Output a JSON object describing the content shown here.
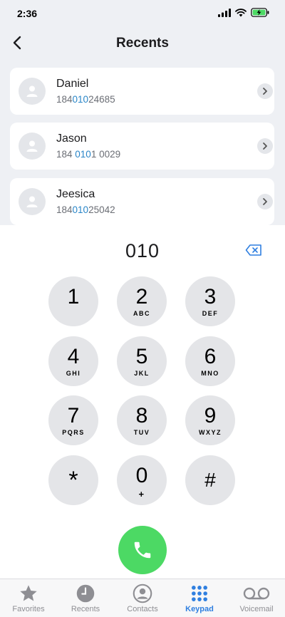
{
  "status_bar": {
    "time": "2:36"
  },
  "nav": {
    "title": "Recents"
  },
  "contacts": [
    {
      "name": "Daniel",
      "number_prefix": "184",
      "number_match": "010",
      "number_suffix": "24685"
    },
    {
      "name": "Jason",
      "number_prefix": "184 ",
      "number_match": "010",
      "number_suffix": "1 0029"
    },
    {
      "name": "Jeesica",
      "number_prefix": "184",
      "number_match": "010",
      "number_suffix": "25042"
    }
  ],
  "dialer": {
    "entered": "010",
    "keys": [
      {
        "digit": "1",
        "letters": ""
      },
      {
        "digit": "2",
        "letters": "ABC"
      },
      {
        "digit": "3",
        "letters": "DEF"
      },
      {
        "digit": "4",
        "letters": "GHI"
      },
      {
        "digit": "5",
        "letters": "JKL"
      },
      {
        "digit": "6",
        "letters": "MNO"
      },
      {
        "digit": "7",
        "letters": "PQRS"
      },
      {
        "digit": "8",
        "letters": "TUV"
      },
      {
        "digit": "9",
        "letters": "WXYZ"
      },
      {
        "digit": "*",
        "letters": ""
      },
      {
        "digit": "0",
        "letters": "+"
      },
      {
        "digit": "#",
        "letters": ""
      }
    ]
  },
  "tabs": [
    {
      "label": "Favorites",
      "icon": "star-icon",
      "active": false
    },
    {
      "label": "Recents",
      "icon": "clock-icon",
      "active": false
    },
    {
      "label": "Contacts",
      "icon": "person-circle-icon",
      "active": false
    },
    {
      "label": "Keypad",
      "icon": "keypad-grid-icon",
      "active": true
    },
    {
      "label": "Voicemail",
      "icon": "voicemail-icon",
      "active": false
    }
  ],
  "colors": {
    "accent": "#2f7fe0",
    "match_highlight": "#2a86c8",
    "call_green": "#4cd964",
    "key_gray": "#e4e5e8",
    "backdrop": "#eef0f4"
  }
}
